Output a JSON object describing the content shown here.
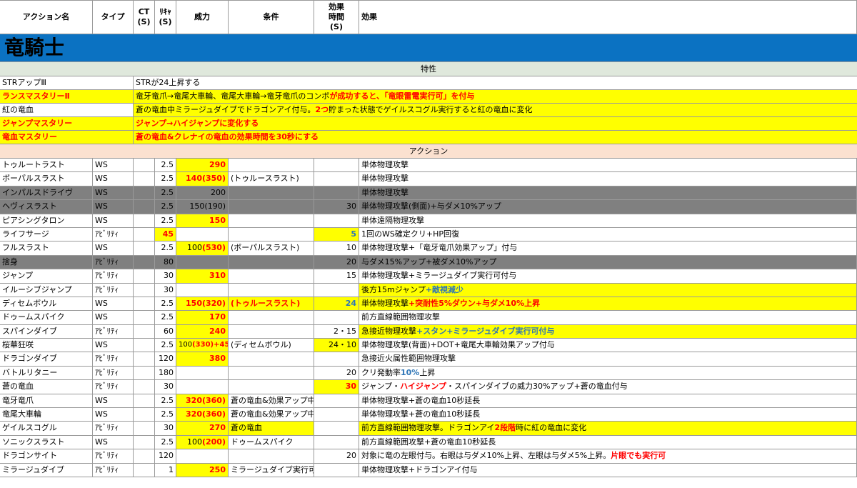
{
  "headers": [
    "アクション名",
    "タイプ",
    "CT\n(S)",
    "ﾘｷｬ\n(S)",
    "威力",
    "条件",
    "効果\n時間\n(S)",
    "効果"
  ],
  "job_title": "竜騎士",
  "sections": {
    "traits": "特性",
    "actions": "アクション"
  },
  "traits": [
    {
      "name": "STRアップⅢ",
      "desc": "STRが24上昇する"
    },
    {
      "name": "ランスマスタリーⅡ",
      "desc_a": "竜牙竜爪→竜尾大車輪、竜尾大車輪→竜牙竜爪のコンボ",
      "desc_b": "が成功すると、「竜眼雷電実行可」を付与"
    },
    {
      "name": "紅の竜血",
      "desc_a": "蒼の竜血中ミラージュダイブでドラゴンアイ付与。",
      "desc_b": "2つ",
      "desc_c": "貯まった状態でゲイルスコグル実行すると紅の竜血に変化"
    },
    {
      "name": "ジャンプマスタリー",
      "desc": "ジャンプ→ハイジャンプに変化する"
    },
    {
      "name": "竜血マスタリー",
      "desc": "蒼の竜血&クレナイの竜血の効果時間を30秒にする"
    }
  ],
  "actions": [
    {
      "name": "トゥルートラスト",
      "type": "WS",
      "ct": "",
      "recast": "2.5",
      "potency": "290",
      "cond": "",
      "dur": "",
      "effect": "単体物理攻撃"
    },
    {
      "name": "ボーパルスラスト",
      "type": "WS",
      "ct": "",
      "recast": "2.5",
      "potency": "140(350)",
      "cond": "(トゥルースラスト)",
      "dur": "",
      "effect": "単体物理攻撃"
    },
    {
      "name": "インパルスドライヴ",
      "type": "WS",
      "ct": "",
      "recast": "2.5",
      "potency": "200",
      "cond": "",
      "dur": "",
      "effect": "単体物理攻撃"
    },
    {
      "name": "ヘヴィスラスト",
      "type": "WS",
      "ct": "",
      "recast": "2.5",
      "potency": "150(190)",
      "cond": "",
      "dur": "30",
      "effect": "単体物理攻撃(側面)+与ダメ10%アップ"
    },
    {
      "name": "ピアシングタロン",
      "type": "WS",
      "ct": "",
      "recast": "2.5",
      "potency": "150",
      "cond": "",
      "dur": "",
      "effect": "単体遠隔物理攻撃"
    },
    {
      "name": "ライフサージ",
      "type": "ｱﾋﾞﾘﾃｨ",
      "ct": "",
      "recast": "45",
      "potency": "",
      "cond": "",
      "dur": "5",
      "effect": "1回のWS確定クリ+HP回復"
    },
    {
      "name": "フルスラスト",
      "type": "WS",
      "ct": "",
      "recast": "2.5",
      "potency": "100(530)",
      "cond": "(ボーパルスラスト)",
      "dur": "10",
      "effect": "単体物理攻撃+「竜牙竜爪効果アップ」付与"
    },
    {
      "name": "捨身",
      "type": "ｱﾋﾞﾘﾃｨ",
      "ct": "",
      "recast": "80",
      "potency": "",
      "cond": "",
      "dur": "20",
      "effect": "与ダメ15%アップ+被ダメ10%アップ"
    },
    {
      "name": "ジャンプ",
      "type": "ｱﾋﾞﾘﾃｨ",
      "ct": "",
      "recast": "30",
      "potency": "310",
      "cond": "",
      "dur": "15",
      "effect": "単体物理攻撃+ミラージュダイブ実行可付与"
    },
    {
      "name": "イルーシブジャンプ",
      "type": "ｱﾋﾞﾘﾃｨ",
      "ct": "",
      "recast": "30",
      "potency": "",
      "cond": "",
      "dur": "",
      "effect_a": "後方15mジャンプ",
      "effect_b": "+敵視減少"
    },
    {
      "name": "ディセムボウル",
      "type": "WS",
      "ct": "",
      "recast": "2.5",
      "potency": "150(320)",
      "cond": "(トゥルースラスト)",
      "dur": "24",
      "effect_a": "単体物理攻撃",
      "effect_b": "+突耐性5%ダウン+与ダメ10%上昇"
    },
    {
      "name": "ドゥームスパイク",
      "type": "WS",
      "ct": "",
      "recast": "2.5",
      "potency": "170",
      "cond": "",
      "dur": "",
      "effect": "前方直線範囲物理攻撃"
    },
    {
      "name": "スパインダイブ",
      "type": "ｱﾋﾞﾘﾃｨ",
      "ct": "",
      "recast": "60",
      "potency": "240",
      "cond": "",
      "dur": "2・15",
      "effect_a": "急接近物理攻撃",
      "effect_b": "+スタン+ミラージュダイブ実行可付与"
    },
    {
      "name": "桜華狂咲",
      "type": "WS",
      "ct": "",
      "recast": "2.5",
      "potency": "100(330)+45",
      "cond": "(ディセムボウル)",
      "dur": "24・10",
      "effect": "単体物理攻撃(背面)+DOT+竜尾大車輪効果アップ付与"
    },
    {
      "name": "ドラゴンダイブ",
      "type": "ｱﾋﾞﾘﾃｨ",
      "ct": "",
      "recast": "120",
      "potency": "380",
      "cond": "",
      "dur": "",
      "effect": "急接近火属性範囲物理攻撃"
    },
    {
      "name": "バトルリタニー",
      "type": "ｱﾋﾞﾘﾃｨ",
      "ct": "",
      "recast": "180",
      "potency": "",
      "cond": "",
      "dur": "20",
      "effect_a": "クリ発動率",
      "effect_b": "10%",
      "effect_c": "上昇"
    },
    {
      "name": "蒼の竜血",
      "type": "ｱﾋﾞﾘﾃｨ",
      "ct": "",
      "recast": "30",
      "potency": "",
      "cond": "",
      "dur": "30",
      "effect_a": "ジャンプ・",
      "effect_b": "ハイジャンプ",
      "effect_c": "・スパインダイブの威力30%アップ+蒼の竜血付与"
    },
    {
      "name": "竜牙竜爪",
      "type": "WS",
      "ct": "",
      "recast": "2.5",
      "potency": "320(360)",
      "cond": "蒼の竜血&効果アップ中",
      "dur": "",
      "effect": "単体物理攻撃+蒼の竜血10秒延長"
    },
    {
      "name": "竜尾大車輪",
      "type": "WS",
      "ct": "",
      "recast": "2.5",
      "potency": "320(360)",
      "cond": "蒼の竜血&効果アップ中",
      "dur": "",
      "effect": "単体物理攻撃+蒼の竜血10秒延長"
    },
    {
      "name": "ゲイルスコグル",
      "type": "ｱﾋﾞﾘﾃｨ",
      "ct": "",
      "recast": "30",
      "potency": "270",
      "cond": "蒼の竜血",
      "dur": "",
      "effect_a": "前方直線範囲物理攻撃。ドラゴンアイ",
      "effect_b": "2段階",
      "effect_c": "時に紅の竜血に変化"
    },
    {
      "name": "ソニックスラスト",
      "type": "WS",
      "ct": "",
      "recast": "2.5",
      "potency": "100(200)",
      "cond": "ドゥームスパイク",
      "dur": "",
      "effect": "前方直線範囲攻撃+蒼の竜血10秒延長"
    },
    {
      "name": "ドラゴンサイト",
      "type": "ｱﾋﾞﾘﾃｨ",
      "ct": "",
      "recast": "120",
      "potency": "",
      "cond": "",
      "dur": "20",
      "effect_a": "対象に竜の左眼付与。右眼は与ダメ10%上昇、左眼は与ダメ5%上昇。",
      "effect_b": "片眼でも実行可"
    },
    {
      "name": "ミラージュダイブ",
      "type": "ｱﾋﾞﾘﾃｨ",
      "ct": "",
      "recast": "1",
      "potency": "250",
      "cond": "ミラージュダイブ実行可",
      "dur": "",
      "effect": "単体物理攻撃+ドラゴンアイ付与"
    }
  ],
  "colors": {
    "title_bar": "#0b72c2",
    "trait_section": "#dfe8dc",
    "action_section": "#fbe1d0",
    "highlight": "#ffff00",
    "gray_row": "#808080",
    "red_text": "#ff0000",
    "blue_text": "#2e75b6"
  }
}
